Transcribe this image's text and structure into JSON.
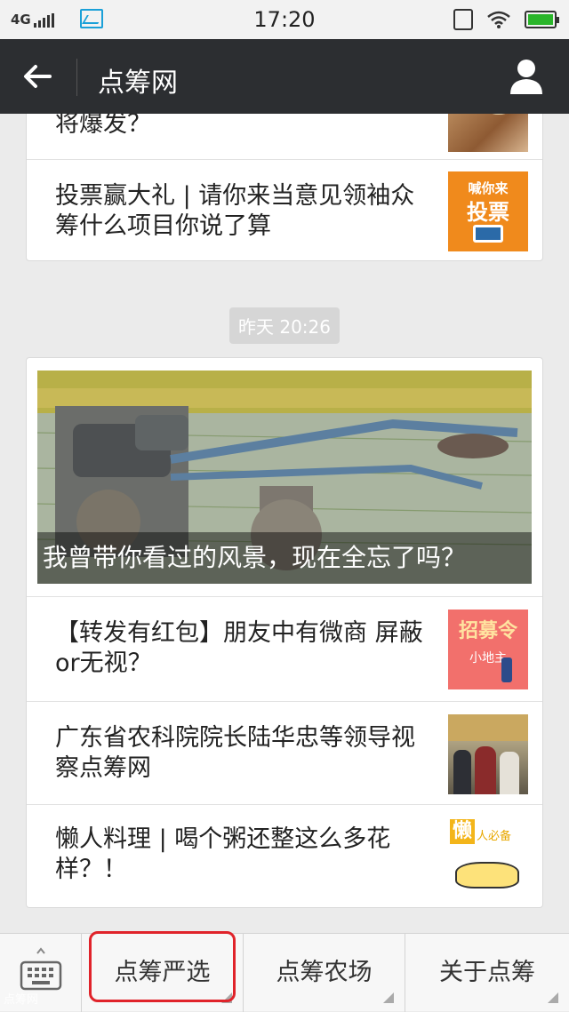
{
  "status_bar": {
    "network": "4G",
    "time": "17:20"
  },
  "nav": {
    "title": "点筹网",
    "back_icon": "back-arrow-icon",
    "profile_icon": "person-icon"
  },
  "articles_top": [
    {
      "title": "将爆发？"
    },
    {
      "title": "投票赢大礼 | 请你来当意见领袖众筹什么项目你说了算",
      "thumb_text_line1": "喊你来",
      "thumb_text_line2": "投票"
    }
  ],
  "timestamp": "昨天 20:26",
  "featured": {
    "caption": "我曾带你看过的风景，现在全忘了吗？"
  },
  "articles_main": [
    {
      "title": "【转发有红包】朋友中有微商 屏蔽or无视？",
      "thumb_text": "招募令",
      "thumb_sub": "小地主"
    },
    {
      "title": "广东省农科院院长陆华忠等领导视察点筹网"
    },
    {
      "title": "懒人料理 | 喝个粥还整这么多花样？！",
      "thumb_text": "懒",
      "thumb_sub": "人必备"
    }
  ],
  "menu": {
    "keyboard_icon": "keyboard-icon",
    "items": [
      "点筹严选",
      "点筹农场",
      "关于点筹"
    ]
  },
  "watermark": "点筹网",
  "colors": {
    "nav_bg": "#2c2e31",
    "highlight": "#e0232a",
    "battery": "#2ab52a"
  }
}
